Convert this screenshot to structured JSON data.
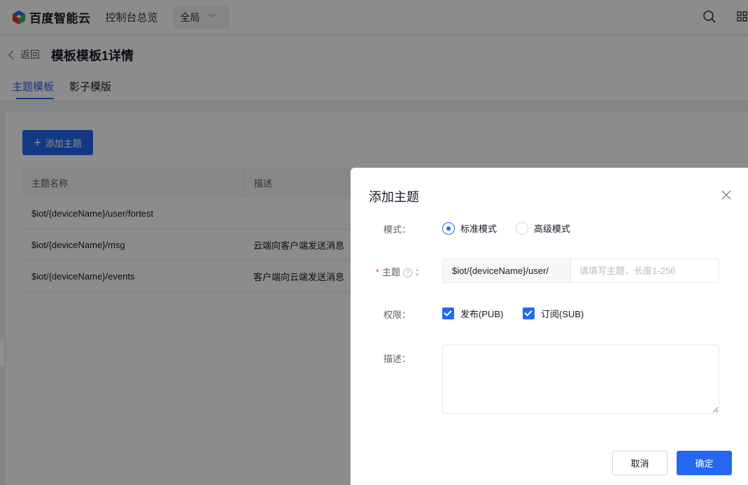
{
  "topbar": {
    "brand": "百度智能云",
    "console_link": "控制台总览",
    "region_label": "全局"
  },
  "header": {
    "back_label": "返回",
    "title": "模板模板1详情",
    "tabs": [
      {
        "label": "主题模板",
        "active": true
      },
      {
        "label": "影子模版",
        "active": false
      }
    ]
  },
  "main": {
    "add_button": "添加主题",
    "table": {
      "columns": [
        "主题名称",
        "描述"
      ],
      "rows": [
        {
          "name": "$iot/{deviceName}/user/fortest",
          "desc": ""
        },
        {
          "name": "$iot/{deviceName}/msg",
          "desc": "云端向客户端发送消息"
        },
        {
          "name": "$iot/{deviceName}/events",
          "desc": "客户端向云端发送消息"
        }
      ]
    }
  },
  "dialog": {
    "title": "添加主题",
    "mode_label": "模式：",
    "mode_options": [
      {
        "label": "标准模式",
        "checked": true
      },
      {
        "label": "高级模式",
        "checked": false
      }
    ],
    "topic_label": "主题",
    "topic_colon": "：",
    "topic_prefix": "$iot/{deviceName}/user/",
    "topic_placeholder": "请填写主题，长度1-256",
    "permission_label": "权限：",
    "permissions": [
      {
        "label": "发布(PUB)",
        "checked": true
      },
      {
        "label": "订阅(SUB)",
        "checked": true
      }
    ],
    "description_label": "描述：",
    "cancel_label": "取消",
    "confirm_label": "确定"
  },
  "colors": {
    "primary": "#2468f2",
    "required": "#f33e3e",
    "mask": "rgba(0,0,0,0.45)"
  },
  "icons": [
    "baidu-cloud-logo-icon",
    "chevron-down-icon",
    "search-icon",
    "app-grid-icon",
    "back-arrow-icon",
    "plus-icon",
    "help-circle-icon",
    "close-icon"
  ]
}
